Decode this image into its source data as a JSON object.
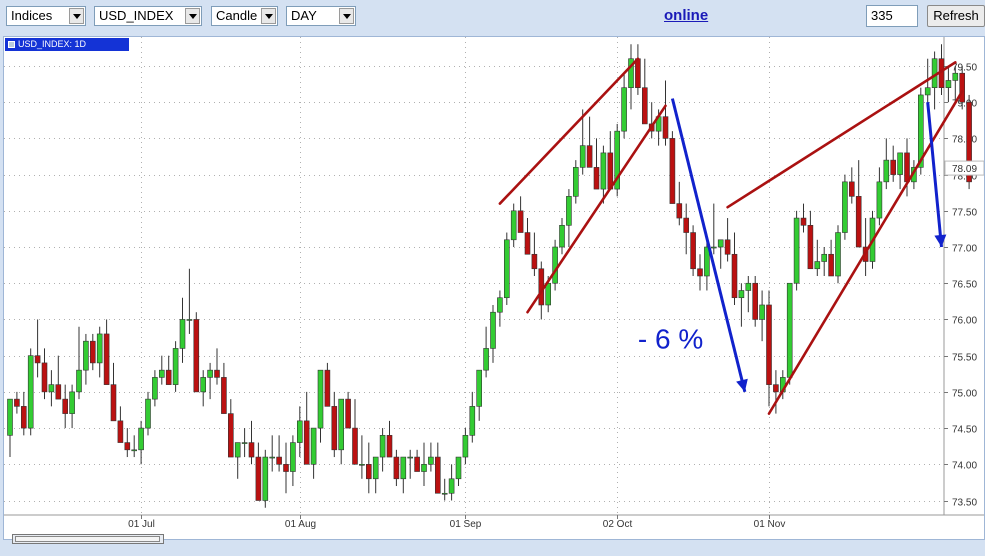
{
  "toolbar": {
    "market": "Indices",
    "symbol": "USD_INDEX",
    "chart_type": "Candle",
    "period": "DAY",
    "online_label": "online",
    "bars_value": "335",
    "refresh_label": "Refresh"
  },
  "chart_title": "USD_INDEX: 1D",
  "annotation_text": "- 6 %",
  "price_marker": "78.09",
  "colors": {
    "up": "#33cc33",
    "down": "#bb1111",
    "trendline": "#aa1111",
    "arrow": "#1122cc",
    "label_bg": "#1433d6"
  },
  "chart_data": {
    "type": "candlestick",
    "ylim": [
      73.3,
      79.9
    ],
    "yticks": [
      73.5,
      74.0,
      74.5,
      75.0,
      75.5,
      76.0,
      76.5,
      77.0,
      77.5,
      78.0,
      78.5,
      79.0,
      79.5
    ],
    "ytick_labels": [
      "73.50",
      "74.00",
      "74.50",
      "75.00",
      "75.50",
      "76.00",
      "76.50",
      "77.00",
      "77.50",
      "78.00",
      "78.50",
      "79.00",
      "79.50"
    ],
    "xtick_labels": [
      "01 Jul",
      "01 Aug",
      "01 Sep",
      "02 Oct",
      "01 Nov"
    ],
    "xtick_index": [
      19,
      42,
      66,
      88,
      110
    ],
    "candles": [
      [
        74.4,
        74.9,
        74.1,
        74.9
      ],
      [
        74.9,
        75.0,
        74.7,
        74.8
      ],
      [
        74.8,
        75.0,
        74.4,
        74.5
      ],
      [
        74.5,
        75.6,
        74.4,
        75.5
      ],
      [
        75.5,
        76.0,
        75.2,
        75.4
      ],
      [
        75.4,
        75.6,
        74.9,
        75.0
      ],
      [
        75.0,
        75.3,
        74.8,
        75.1
      ],
      [
        75.1,
        75.5,
        74.9,
        74.9
      ],
      [
        74.9,
        75.1,
        74.5,
        74.7
      ],
      [
        74.7,
        75.1,
        74.5,
        75.0
      ],
      [
        75.0,
        75.9,
        74.9,
        75.3
      ],
      [
        75.3,
        75.8,
        75.1,
        75.7
      ],
      [
        75.7,
        75.8,
        75.3,
        75.4
      ],
      [
        75.4,
        75.9,
        75.2,
        75.8
      ],
      [
        75.8,
        76.0,
        75.2,
        75.1
      ],
      [
        75.1,
        75.4,
        74.7,
        74.6
      ],
      [
        74.6,
        74.8,
        74.4,
        74.3
      ],
      [
        74.3,
        74.5,
        74.1,
        74.2
      ],
      [
        74.2,
        74.4,
        74.1,
        74.2
      ],
      [
        74.2,
        74.6,
        74.0,
        74.5
      ],
      [
        74.5,
        75.0,
        74.4,
        74.9
      ],
      [
        74.9,
        75.3,
        74.8,
        75.2
      ],
      [
        75.2,
        75.5,
        75.1,
        75.3
      ],
      [
        75.3,
        75.5,
        75.1,
        75.1
      ],
      [
        75.1,
        75.7,
        75.0,
        75.6
      ],
      [
        75.6,
        76.3,
        75.4,
        76.0
      ],
      [
        76.0,
        76.7,
        75.8,
        76.0
      ],
      [
        76.0,
        76.1,
        75.1,
        75.0
      ],
      [
        75.0,
        75.3,
        74.8,
        75.2
      ],
      [
        75.2,
        75.4,
        74.9,
        75.3
      ],
      [
        75.3,
        75.6,
        75.1,
        75.2
      ],
      [
        75.2,
        75.4,
        74.7,
        74.7
      ],
      [
        74.7,
        74.9,
        74.3,
        74.1
      ],
      [
        74.1,
        74.3,
        73.8,
        74.3
      ],
      [
        74.3,
        74.5,
        74.1,
        74.3
      ],
      [
        74.3,
        74.6,
        74.0,
        74.1
      ],
      [
        74.1,
        74.3,
        73.5,
        73.5
      ],
      [
        73.5,
        74.2,
        73.4,
        74.1
      ],
      [
        74.1,
        74.4,
        73.9,
        74.1
      ],
      [
        74.1,
        74.4,
        73.9,
        74.0
      ],
      [
        74.0,
        74.3,
        73.6,
        73.9
      ],
      [
        73.9,
        74.4,
        73.7,
        74.3
      ],
      [
        74.3,
        74.8,
        74.1,
        74.6
      ],
      [
        74.6,
        75.0,
        74.4,
        74.0
      ],
      [
        74.0,
        74.3,
        73.8,
        74.5
      ],
      [
        74.5,
        75.2,
        74.3,
        75.3
      ],
      [
        75.3,
        75.4,
        74.8,
        74.8
      ],
      [
        74.8,
        75.0,
        74.1,
        74.2
      ],
      [
        74.2,
        74.9,
        74.0,
        74.9
      ],
      [
        74.9,
        75.0,
        74.5,
        74.5
      ],
      [
        74.5,
        74.9,
        74.0,
        74.0
      ],
      [
        74.0,
        74.4,
        73.8,
        74.0
      ],
      [
        74.0,
        74.3,
        73.6,
        73.8
      ],
      [
        73.8,
        74.1,
        73.6,
        74.1
      ],
      [
        74.1,
        74.5,
        73.9,
        74.4
      ],
      [
        74.4,
        74.6,
        74.1,
        74.1
      ],
      [
        74.1,
        74.2,
        73.7,
        73.8
      ],
      [
        73.8,
        74.0,
        73.6,
        74.1
      ],
      [
        74.1,
        74.2,
        73.8,
        74.1
      ],
      [
        74.1,
        74.2,
        73.9,
        73.9
      ],
      [
        73.9,
        74.3,
        73.7,
        74.0
      ],
      [
        74.0,
        74.3,
        73.9,
        74.1
      ],
      [
        74.1,
        74.3,
        73.7,
        73.6
      ],
      [
        73.6,
        73.8,
        73.5,
        73.6
      ],
      [
        73.6,
        74.0,
        73.5,
        73.8
      ],
      [
        73.8,
        74.1,
        73.7,
        74.1
      ],
      [
        74.1,
        74.5,
        74.0,
        74.4
      ],
      [
        74.4,
        75.0,
        74.3,
        74.8
      ],
      [
        74.8,
        75.3,
        74.6,
        75.3
      ],
      [
        75.3,
        75.9,
        75.2,
        75.6
      ],
      [
        75.6,
        76.2,
        75.4,
        76.1
      ],
      [
        76.1,
        76.4,
        75.9,
        76.3
      ],
      [
        76.3,
        77.2,
        76.2,
        77.1
      ],
      [
        77.1,
        77.6,
        77.0,
        77.5
      ],
      [
        77.5,
        77.7,
        77.3,
        77.2
      ],
      [
        77.2,
        77.4,
        76.9,
        76.9
      ],
      [
        76.9,
        77.2,
        76.6,
        76.7
      ],
      [
        76.7,
        76.8,
        76.0,
        76.2
      ],
      [
        76.2,
        76.6,
        76.1,
        76.5
      ],
      [
        76.5,
        77.1,
        76.4,
        77.0
      ],
      [
        77.0,
        77.4,
        76.9,
        77.3
      ],
      [
        77.3,
        77.8,
        77.0,
        77.7
      ],
      [
        77.7,
        78.2,
        77.6,
        78.1
      ],
      [
        78.1,
        78.9,
        78.0,
        78.4
      ],
      [
        78.4,
        78.8,
        78.2,
        78.1
      ],
      [
        78.1,
        78.5,
        77.9,
        77.8
      ],
      [
        77.8,
        78.4,
        77.6,
        78.3
      ],
      [
        78.3,
        78.6,
        77.9,
        77.8
      ],
      [
        77.8,
        78.7,
        77.7,
        78.6
      ],
      [
        78.6,
        79.4,
        78.5,
        79.2
      ],
      [
        79.2,
        79.8,
        78.9,
        79.6
      ],
      [
        79.6,
        79.8,
        79.1,
        79.2
      ],
      [
        79.2,
        79.6,
        78.9,
        78.7
      ],
      [
        78.7,
        79.0,
        78.5,
        78.6
      ],
      [
        78.6,
        78.9,
        78.4,
        78.8
      ],
      [
        78.8,
        79.3,
        78.4,
        78.5
      ],
      [
        78.5,
        78.6,
        77.6,
        77.6
      ],
      [
        77.6,
        77.9,
        77.3,
        77.4
      ],
      [
        77.4,
        77.6,
        76.9,
        77.2
      ],
      [
        77.2,
        77.3,
        76.6,
        76.7
      ],
      [
        76.7,
        76.9,
        76.4,
        76.6
      ],
      [
        76.6,
        77.1,
        76.4,
        77.0
      ],
      [
        77.0,
        77.6,
        76.9,
        77.0
      ],
      [
        77.0,
        77.1,
        76.7,
        77.1
      ],
      [
        77.1,
        77.4,
        76.8,
        76.9
      ],
      [
        76.9,
        77.2,
        76.2,
        76.3
      ],
      [
        76.3,
        76.5,
        75.9,
        76.4
      ],
      [
        76.4,
        76.6,
        76.1,
        76.5
      ],
      [
        76.5,
        76.6,
        75.9,
        76.0
      ],
      [
        76.0,
        76.4,
        75.7,
        76.2
      ],
      [
        76.2,
        76.4,
        74.8,
        75.1
      ],
      [
        75.1,
        75.3,
        74.7,
        75.0
      ],
      [
        75.0,
        75.3,
        74.9,
        75.2
      ],
      [
        75.2,
        76.5,
        75.1,
        76.5
      ],
      [
        76.5,
        77.5,
        76.4,
        77.4
      ],
      [
        77.4,
        77.6,
        77.2,
        77.3
      ],
      [
        77.3,
        77.5,
        76.7,
        76.7
      ],
      [
        76.7,
        77.1,
        76.6,
        76.8
      ],
      [
        76.8,
        77.0,
        76.6,
        76.9
      ],
      [
        76.9,
        77.1,
        76.6,
        76.6
      ],
      [
        76.6,
        77.3,
        76.5,
        77.2
      ],
      [
        77.2,
        78.0,
        77.1,
        77.9
      ],
      [
        77.9,
        78.1,
        77.6,
        77.7
      ],
      [
        77.7,
        78.2,
        77.5,
        77.0
      ],
      [
        77.0,
        77.4,
        76.6,
        76.8
      ],
      [
        76.8,
        77.5,
        76.7,
        77.4
      ],
      [
        77.4,
        78.1,
        77.3,
        77.9
      ],
      [
        77.9,
        78.5,
        77.8,
        78.2
      ],
      [
        78.2,
        78.4,
        77.9,
        78.0
      ],
      [
        78.0,
        78.3,
        77.8,
        78.3
      ],
      [
        78.3,
        78.5,
        77.7,
        77.9
      ],
      [
        77.9,
        78.2,
        77.8,
        78.1
      ],
      [
        78.1,
        79.2,
        78.0,
        79.1
      ],
      [
        79.1,
        79.6,
        78.9,
        79.2
      ],
      [
        79.2,
        79.7,
        78.9,
        79.6
      ],
      [
        79.6,
        79.8,
        79.1,
        79.2
      ],
      [
        79.2,
        79.5,
        79.0,
        79.3
      ],
      [
        79.3,
        79.5,
        79.0,
        79.4
      ],
      [
        79.4,
        79.5,
        78.9,
        79.0
      ],
      [
        79.0,
        79.1,
        77.8,
        77.9
      ]
    ]
  }
}
